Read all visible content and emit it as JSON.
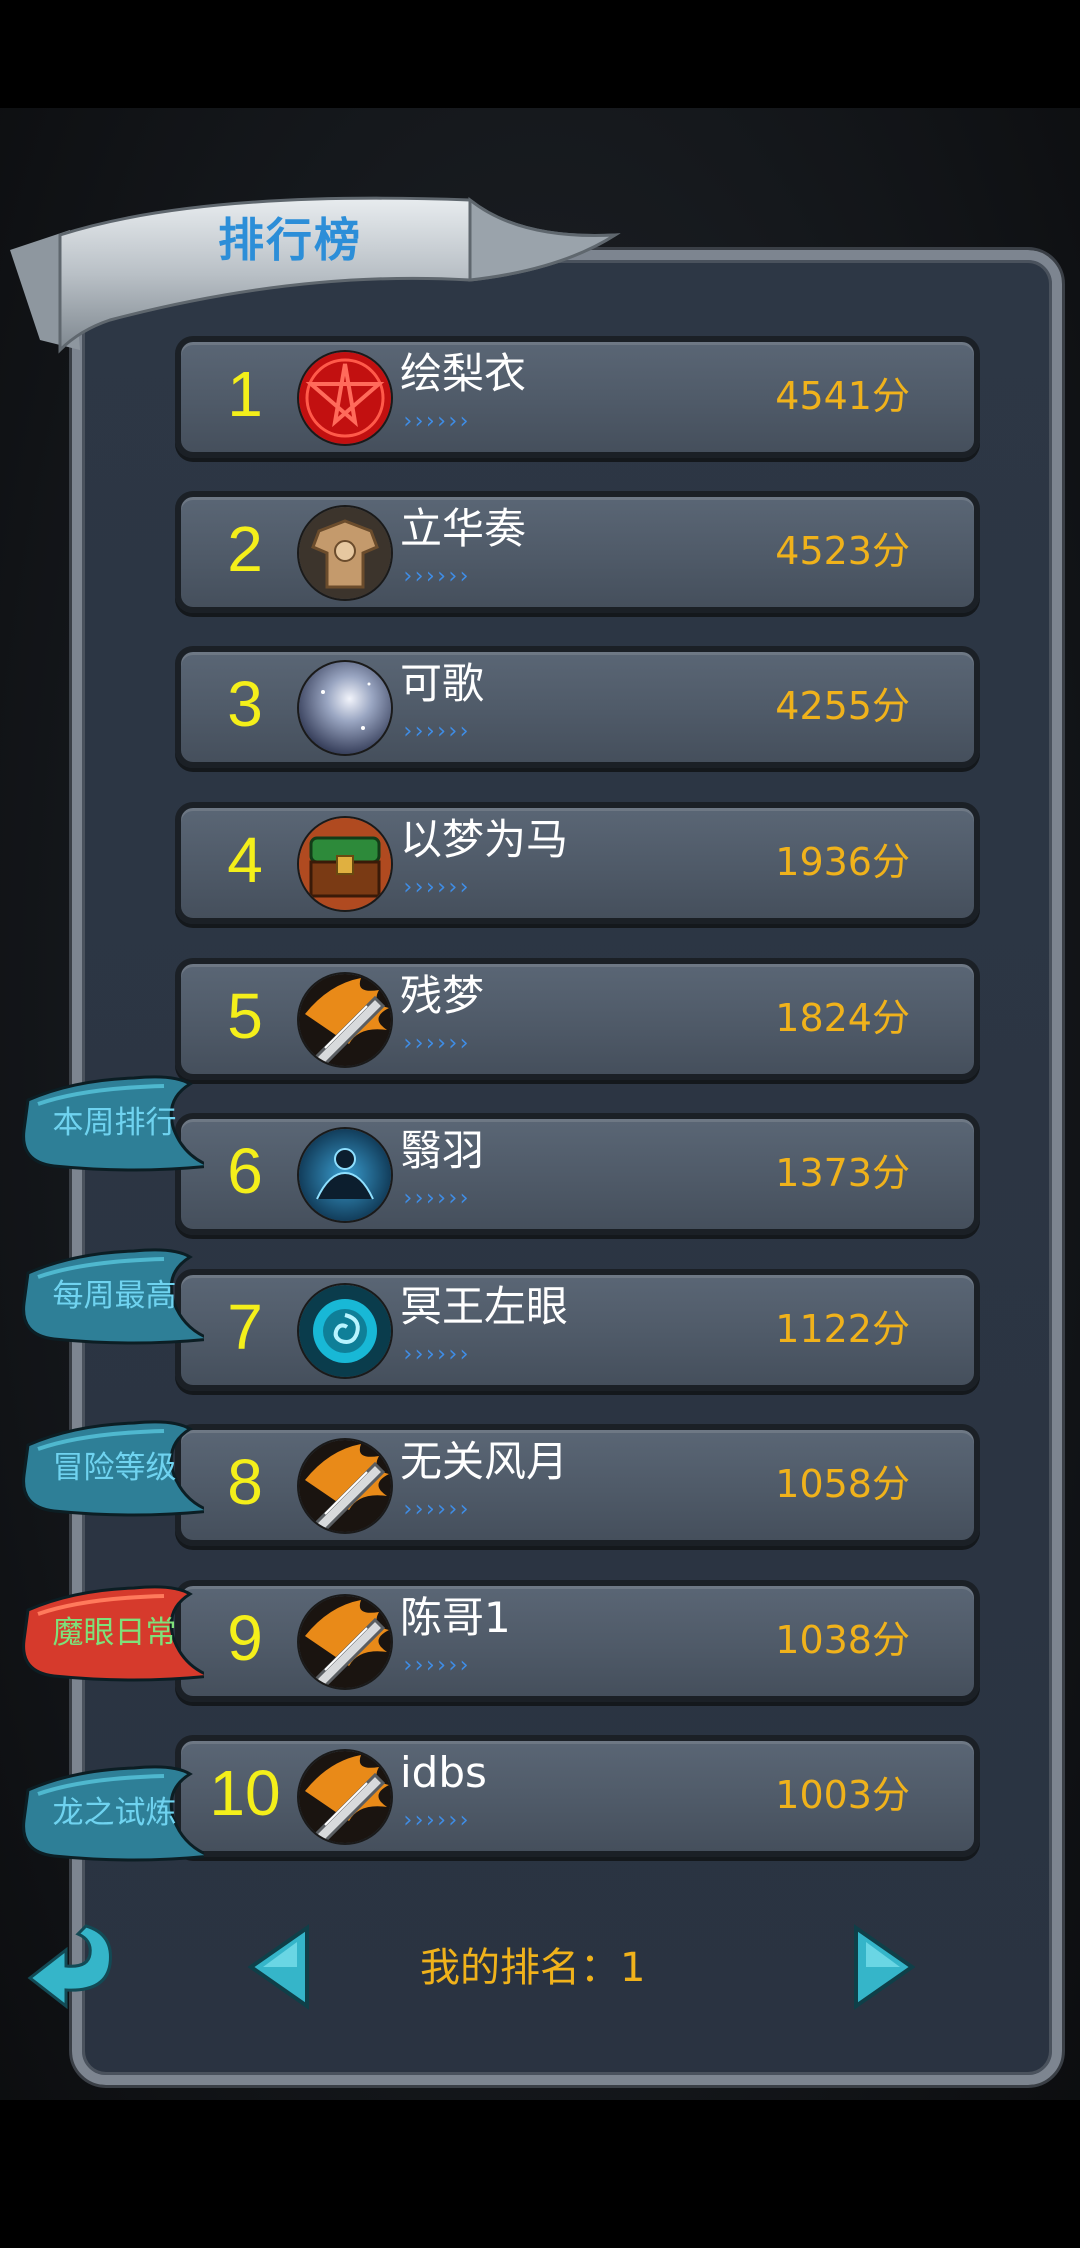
{
  "header": {
    "title": "排行榜"
  },
  "rankings": [
    {
      "rank": "1",
      "name": "绘梨衣",
      "score": "4541分",
      "avatar": "pentagram-icon"
    },
    {
      "rank": "2",
      "name": "立华奏",
      "score": "4523分",
      "avatar": "armor-icon"
    },
    {
      "rank": "3",
      "name": "可歌",
      "score": "4255分",
      "avatar": "galaxy-icon"
    },
    {
      "rank": "4",
      "name": "以梦为马",
      "score": "1936分",
      "avatar": "treasure-chest-icon"
    },
    {
      "rank": "5",
      "name": "残梦",
      "score": "1824分",
      "avatar": "flaming-blade-icon"
    },
    {
      "rank": "6",
      "name": "翳羽",
      "score": "1373分",
      "avatar": "spirit-figure-icon"
    },
    {
      "rank": "7",
      "name": "冥王左眼",
      "score": "1122分",
      "avatar": "vortex-icon"
    },
    {
      "rank": "8",
      "name": "无关风月",
      "score": "1058分",
      "avatar": "flaming-blade-icon"
    },
    {
      "rank": "9",
      "name": "陈哥1",
      "score": "1038分",
      "avatar": "flaming-blade-icon"
    },
    {
      "rank": "10",
      "name": "idbs",
      "score": "1003分",
      "avatar": "flaming-blade-icon"
    }
  ],
  "row_arrows": "››››››",
  "side_tabs": [
    {
      "label": "本周排行",
      "active": false
    },
    {
      "label": "每周最高",
      "active": false
    },
    {
      "label": "冒险等级",
      "active": false
    },
    {
      "label": "魔眼日常",
      "active": true
    },
    {
      "label": "龙之试炼",
      "active": false
    }
  ],
  "footer": {
    "my_rank_label": "我的排名：1",
    "back_icon": "back-arrow-icon",
    "prev_icon": "triangle-left-icon",
    "next_icon": "triangle-right-icon"
  },
  "colors": {
    "rank_number": "#f4ef1a",
    "score": "#f0b21b",
    "title": "#2c8ed8",
    "tab_text": "#6fd3f0",
    "tab_active_text": "#7fe07a",
    "tab_active_bg": "#d63a2c",
    "tab_bg": "#2e7f97",
    "arrow_button": "#35b5c9"
  }
}
